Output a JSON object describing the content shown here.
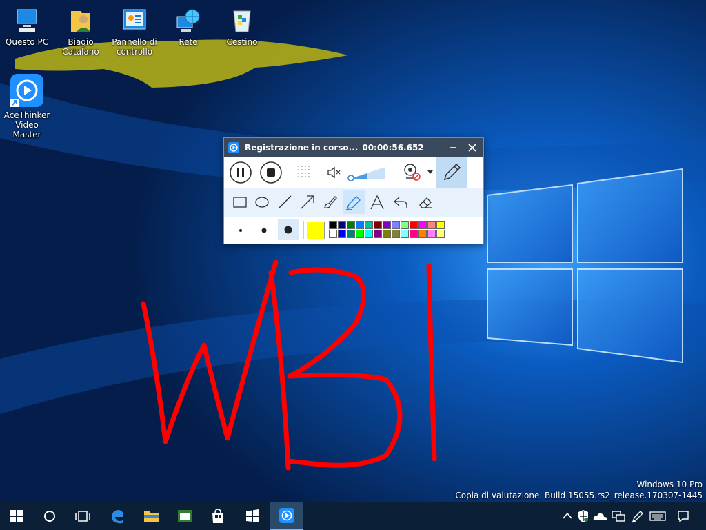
{
  "desktop": {
    "icons": [
      {
        "label": "Questo PC",
        "icon": "computer-icon"
      },
      {
        "label": "Biagio Catalano",
        "icon": "user-folder-icon"
      },
      {
        "label": "Pannello di controllo",
        "icon": "control-panel-icon"
      },
      {
        "label": "Rete",
        "icon": "network-icon"
      },
      {
        "label": "Cestino",
        "icon": "recycle-bin-icon"
      },
      {
        "label": "AceThinker Video Master",
        "icon": "acethinker-icon"
      }
    ],
    "watermark": {
      "line1": "Windows 10 Pro",
      "line2": "Copia di valutazione. Build 15055.rs2_release.170307-1445"
    },
    "highlight_color": "#a9a51a",
    "drawing_color": "#ff0000"
  },
  "recorder": {
    "title": "Registrazione in corso...",
    "timer": "00:00:56.652",
    "colors": {
      "titlebar": "#3a4a5c",
      "selected_color": "#ffff00",
      "palette": [
        "#000000",
        "#000080",
        "#008000",
        "#0080ff",
        "#00c0a0",
        "#800000",
        "#8000c0",
        "#8080ff",
        "#80ff80",
        "#ff0000",
        "#ff00ff",
        "#ff8080",
        "#ffff00",
        "#ffffff",
        "#0000ff",
        "#008080",
        "#00ff00",
        "#00ffff",
        "#800080",
        "#808000",
        "#808040",
        "#80ffff",
        "#ff0080",
        "#ff8000",
        "#ff80ff",
        "#ffff80"
      ]
    }
  },
  "taskbar": {
    "items": [
      "start-icon",
      "search-icon",
      "task-view-icon",
      "edge-icon",
      "file-explorer-icon",
      "app-icon",
      "store-icon",
      "app-icon-2",
      "acethinker-taskbar-icon"
    ]
  }
}
